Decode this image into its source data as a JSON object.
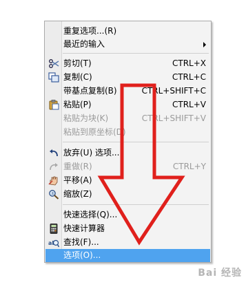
{
  "menu": {
    "items": [
      {
        "label": "重复选项...(R)",
        "shortcut": "",
        "icon": "",
        "disabled": false,
        "submenu": false
      },
      {
        "label": "最近的输入",
        "shortcut": "",
        "icon": "",
        "disabled": false,
        "submenu": true
      },
      {
        "label": "剪切(T)",
        "shortcut": "CTRL+X",
        "icon": "scissors-icon",
        "disabled": false,
        "submenu": false
      },
      {
        "label": "复制(C)",
        "shortcut": "CTRL+C",
        "icon": "copy-icon",
        "disabled": false,
        "submenu": false
      },
      {
        "label": "带基点复制(B)",
        "shortcut": "CTRL+SHIFT+C",
        "icon": "",
        "disabled": false,
        "submenu": false
      },
      {
        "label": "粘贴(P)",
        "shortcut": "CTRL+V",
        "icon": "paste-icon",
        "disabled": false,
        "submenu": false
      },
      {
        "label": "粘贴为块(K)",
        "shortcut": "CTRL+SHIFT+V",
        "icon": "",
        "disabled": true,
        "submenu": false
      },
      {
        "label": "粘贴到原坐标(D)",
        "shortcut": "",
        "icon": "",
        "disabled": true,
        "submenu": false
      },
      {
        "label": "放弃(U) 选项...",
        "shortcut": "",
        "icon": "undo-icon",
        "disabled": false,
        "submenu": false
      },
      {
        "label": "重做(R)",
        "shortcut": "CTRL+Y",
        "icon": "redo-icon",
        "disabled": true,
        "submenu": false
      },
      {
        "label": "平移(A)",
        "shortcut": "",
        "icon": "pan-icon",
        "disabled": false,
        "submenu": false
      },
      {
        "label": "缩放(Z)",
        "shortcut": "",
        "icon": "zoom-icon",
        "disabled": false,
        "submenu": false
      },
      {
        "label": "快速选择(Q)...",
        "shortcut": "",
        "icon": "",
        "disabled": false,
        "submenu": false
      },
      {
        "label": "快速计算器",
        "shortcut": "",
        "icon": "calculator-icon",
        "disabled": false,
        "submenu": false
      },
      {
        "label": "查找(F)...",
        "shortcut": "",
        "icon": "find-icon",
        "disabled": false,
        "submenu": false
      },
      {
        "label": "选项(O)...",
        "shortcut": "",
        "icon": "",
        "disabled": false,
        "submenu": false,
        "highlighted": true
      }
    ]
  },
  "colors": {
    "highlight": "#4fa3ef",
    "annotation_arrow": "#e0201c"
  },
  "watermark": "Bai 经验"
}
